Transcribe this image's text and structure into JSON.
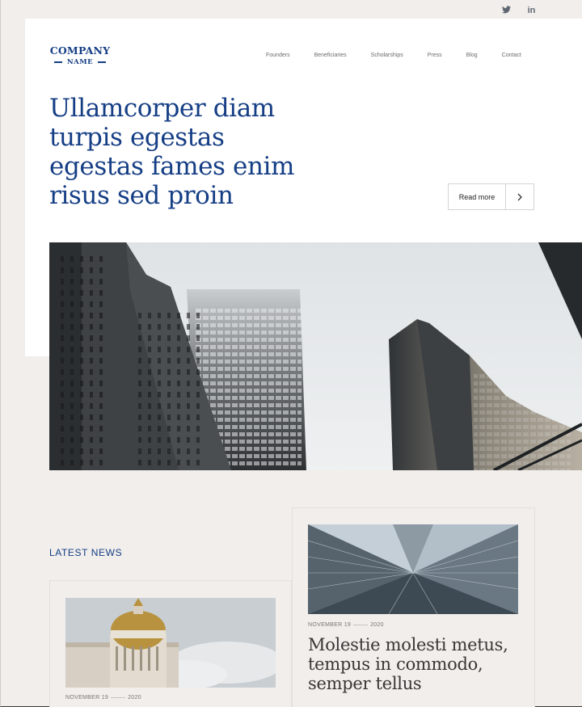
{
  "social": {
    "twitter": "twitter-icon",
    "linkedin": "in"
  },
  "logo": {
    "line1": "COMPANY",
    "line2": "NAME"
  },
  "nav": {
    "items": [
      "Founders",
      "Beneficiaries",
      "Scholarships",
      "Press",
      "Blog",
      "Contact"
    ]
  },
  "hero": {
    "headline": "Ullamcorper diam turpis egestas egestas fames enim risus sed proin",
    "read_more": "Read more"
  },
  "news": {
    "section_title": "LATEST NEWS",
    "items": [
      {
        "month_day": "NOVEMBER 19",
        "year": "2020",
        "title": ""
      },
      {
        "month_day": "NOVEMBER 19",
        "year": "2020",
        "title": "Molestie molesti metus, tempus in commodo, semper tellus"
      }
    ]
  },
  "colors": {
    "brand": "#153e85",
    "background": "#f1eeec",
    "card": "#ffffff"
  }
}
